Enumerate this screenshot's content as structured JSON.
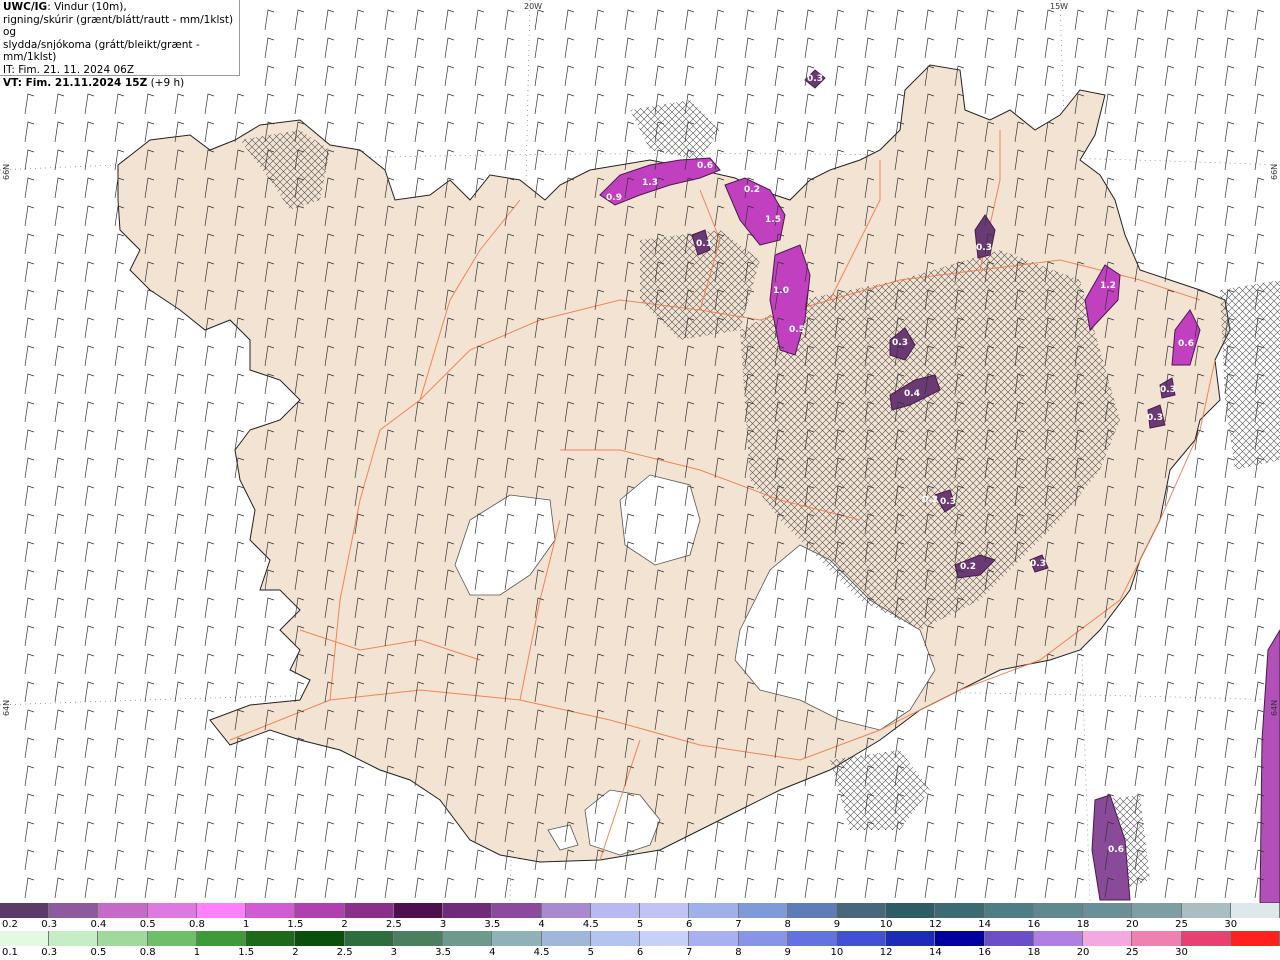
{
  "title": {
    "model": "UWC/IG",
    "line1_rest": ": Vindur (10m),",
    "line2": "rigning/skúrir (grænt/blátt/rautt - mm/1klst) og",
    "line3": "slydda/snjókoma (grátt/bleikt/grænt - mm/1klst)",
    "it": "IT: Fim. 21. 11. 2024 06Z",
    "vt_bold": "VT: Fim. 21.11.2024 15Z",
    "vt_rest": " (+9 h)"
  },
  "axes": {
    "lon_labels": [
      "20W",
      "15W"
    ],
    "lat_labels": [
      "66N",
      "64N",
      "66N",
      "64N"
    ]
  },
  "precip_labels": [
    "0.9",
    "1.3",
    "0.6",
    "0.2",
    "1.5",
    "0.1",
    "1.0",
    "0.5",
    "0.3",
    "0.3",
    "0.4",
    "1.2",
    "0.6",
    "0.3",
    "0.3",
    "0.2",
    "0.3",
    "0.2",
    "0.3",
    "0.6",
    "0.3"
  ],
  "legend_snow": {
    "labels": [
      "0.2",
      "0.3",
      "0.4",
      "0.5",
      "0.8",
      "1",
      "1.5",
      "2",
      "2.5",
      "3",
      "3.5",
      "4",
      "4.5",
      "5",
      "6",
      "7",
      "8",
      "9",
      "10",
      "12",
      "14",
      "16",
      "18",
      "20",
      "25",
      "30"
    ],
    "colors": [
      "#5c3b67",
      "#8e5a9e",
      "#c66ac8",
      "#df79e2",
      "#ff80ff",
      "#d25bd3",
      "#b040b0",
      "#8a2f8a",
      "#4f0f4f",
      "#6f2a7a",
      "#8c4a9e",
      "#a88ad0",
      "#b8b8f2",
      "#c0c4f5",
      "#9fb0ea",
      "#8099d8",
      "#5f7cb8",
      "#48667c",
      "#2f5b66",
      "#3b6a72",
      "#4f7d85",
      "#5f8890",
      "#6a8f96",
      "#7f9ea3",
      "#a8bec0",
      "#dde8ea"
    ]
  },
  "legend_rain": {
    "labels": [
      "0.1",
      "0.3",
      "0.5",
      "0.8",
      "1",
      "1.5",
      "2",
      "2.5",
      "3",
      "3.5",
      "4",
      "4.5",
      "5",
      "6",
      "7",
      "8",
      "9",
      "10",
      "12",
      "14",
      "16",
      "18",
      "20",
      "25",
      "30"
    ],
    "colors": [
      "#e4f8e4",
      "#c6eec4",
      "#9fd99c",
      "#6fbf6a",
      "#3f9a3a",
      "#1c6a1a",
      "#0a4f0a",
      "#2e6e3e",
      "#4a8060",
      "#6c9a8c",
      "#8fb2b8",
      "#9fb8da",
      "#b4c4f0",
      "#c8d0f8",
      "#a8b0f0",
      "#8894e8",
      "#6272e0",
      "#4250d8",
      "#1c2cb8",
      "#0000a0",
      "#6a4fc8",
      "#b080e0",
      "#f4a8e0",
      "#f080b0",
      "#e84070",
      "#ff2020"
    ]
  }
}
